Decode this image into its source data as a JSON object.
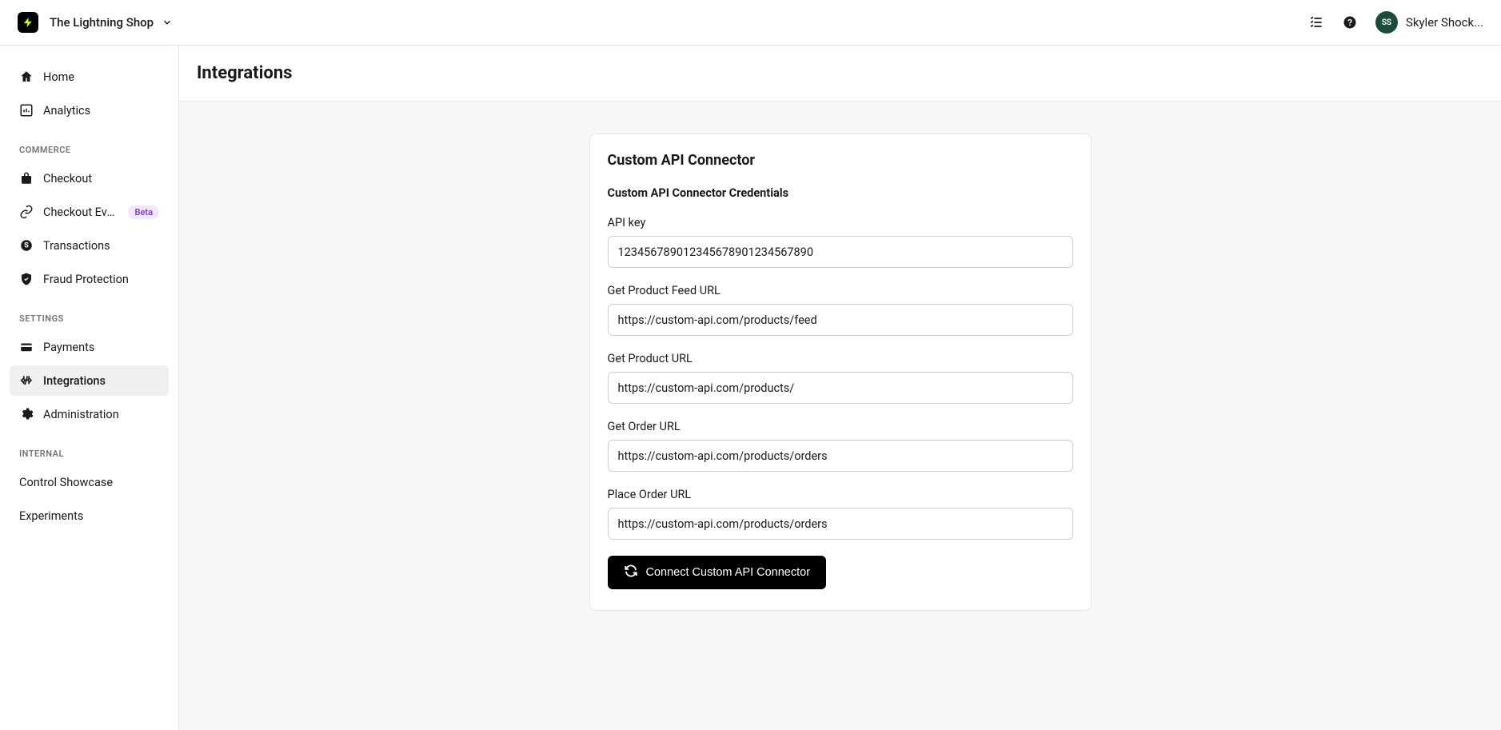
{
  "header": {
    "shop_name": "The Lightning Shop",
    "user_initials": "SS",
    "user_name": "Skyler Shock..."
  },
  "sidebar": {
    "top": [
      {
        "label": "Home"
      },
      {
        "label": "Analytics"
      }
    ],
    "commerce_label": "COMMERCE",
    "commerce": [
      {
        "label": "Checkout"
      },
      {
        "label": "Checkout Everyw...",
        "badge": "Beta"
      },
      {
        "label": "Transactions"
      },
      {
        "label": "Fraud Protection"
      }
    ],
    "settings_label": "SETTINGS",
    "settings": [
      {
        "label": "Payments"
      },
      {
        "label": "Integrations"
      },
      {
        "label": "Administration"
      }
    ],
    "internal_label": "INTERNAL",
    "internal": [
      {
        "label": "Control Showcase"
      },
      {
        "label": "Experiments"
      }
    ]
  },
  "page": {
    "title": "Integrations"
  },
  "card": {
    "title": "Custom API Connector",
    "subtitle": "Custom API Connector Credentials",
    "fields": {
      "api_key": {
        "label": "API key",
        "value": "123456789012345678901234567890"
      },
      "product_feed_url": {
        "label": "Get Product Feed URL",
        "value": "https://custom-api.com/products/feed"
      },
      "product_url": {
        "label": "Get Product URL",
        "value": "https://custom-api.com/products/"
      },
      "get_order_url": {
        "label": "Get Order URL",
        "value": "https://custom-api.com/products/orders"
      },
      "place_order_url": {
        "label": "Place Order URL",
        "value": "https://custom-api.com/products/orders"
      }
    },
    "button_label": "Connect Custom API Connector"
  }
}
